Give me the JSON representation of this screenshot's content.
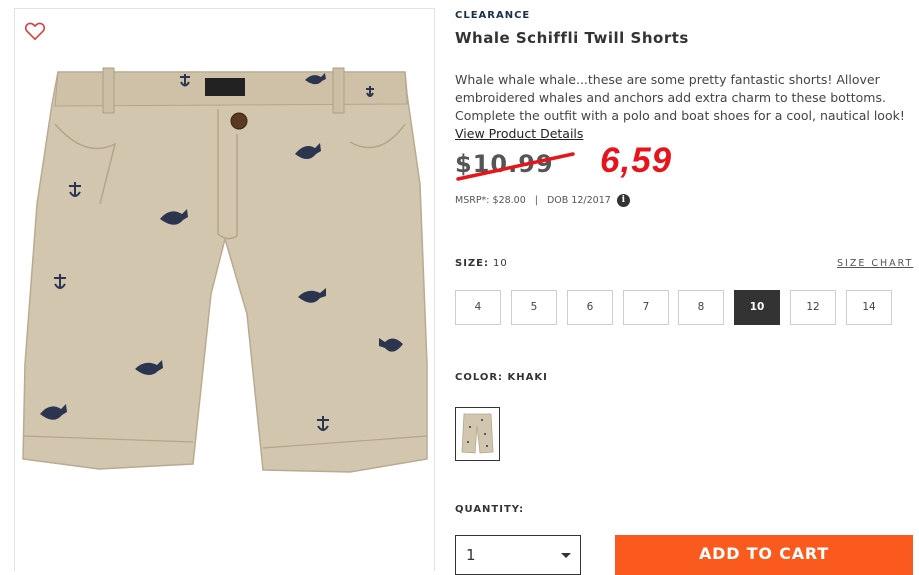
{
  "product": {
    "category_label": "CLEARANCE",
    "title": "Whale Schiffli Twill Shorts",
    "description": "Whale whale whale...these are some pretty fantastic shorts! Allover embroidered whales and anchors add extra charm to these bottoms. Complete the outfit with a polo and boat shoes for a cool, nautical look!",
    "details_link": "View Product Details"
  },
  "price": {
    "original": "$10.99",
    "handwritten_new": "6,59",
    "msrp": "MSRP*: $28.00",
    "separator": "|",
    "dob": "DOB 12/2017",
    "info_icon_glyph": "i"
  },
  "size": {
    "label": "SIZE:",
    "value": "10",
    "chart_link": "SIZE CHART",
    "options": [
      "4",
      "5",
      "6",
      "7",
      "8",
      "10",
      "12",
      "14"
    ],
    "selected": "10"
  },
  "color": {
    "label": "COLOR:",
    "value": "KHAKI",
    "swatch_color": "#d3c6ae"
  },
  "quantity": {
    "label": "QUANTITY:",
    "value": "1"
  },
  "cart": {
    "add_label": "ADD TO CART",
    "button_color": "#fb5a1e"
  },
  "icons": {
    "favorite": "heart-outline-icon",
    "dropdown": "chevron-down-icon",
    "info": "info-icon"
  },
  "colors": {
    "price_red": "#e8141c",
    "brand_navy": "#1c2e4a",
    "fabric_khaki": "#d3c6ae"
  }
}
